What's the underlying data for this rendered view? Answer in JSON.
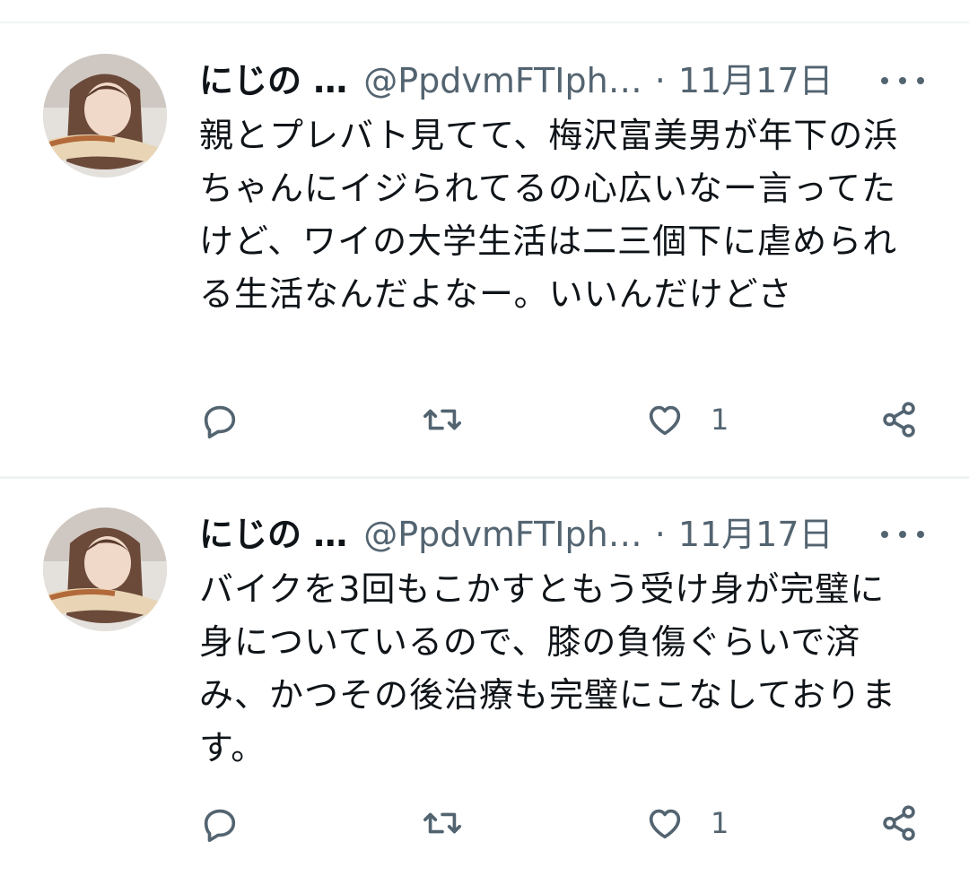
{
  "tweets": [
    {
      "author_name": "にじの …",
      "handle": "@PpdvmFTIph…",
      "separator": "·",
      "date": "11月17日",
      "text": "親とプレバト見てて、梅沢富美男が年下の浜ちゃんにイジられてるの心広いなー言ってたけど、ワイの大学生活は二三個下に虐められる生活なんだよなー。いいんだけどさ",
      "like_count": "1",
      "icons": [
        "reply-icon",
        "retweet-icon",
        "like-icon",
        "share-icon",
        "more-icon"
      ]
    },
    {
      "author_name": "にじの …",
      "handle": "@PpdvmFTIph…",
      "separator": "·",
      "date": "11月17日",
      "text": "バイクを3回もこかすともう受け身が完璧に身についているので、膝の負傷ぐらいで済み、かつその後治療も完璧にこなしております。",
      "like_count": "1",
      "icons": [
        "reply-icon",
        "retweet-icon",
        "like-icon",
        "share-icon",
        "more-icon"
      ]
    }
  ],
  "colors": {
    "text_primary": "#0f1419",
    "text_secondary": "#536471",
    "divider": "#eff3f4",
    "background": "#ffffff"
  }
}
